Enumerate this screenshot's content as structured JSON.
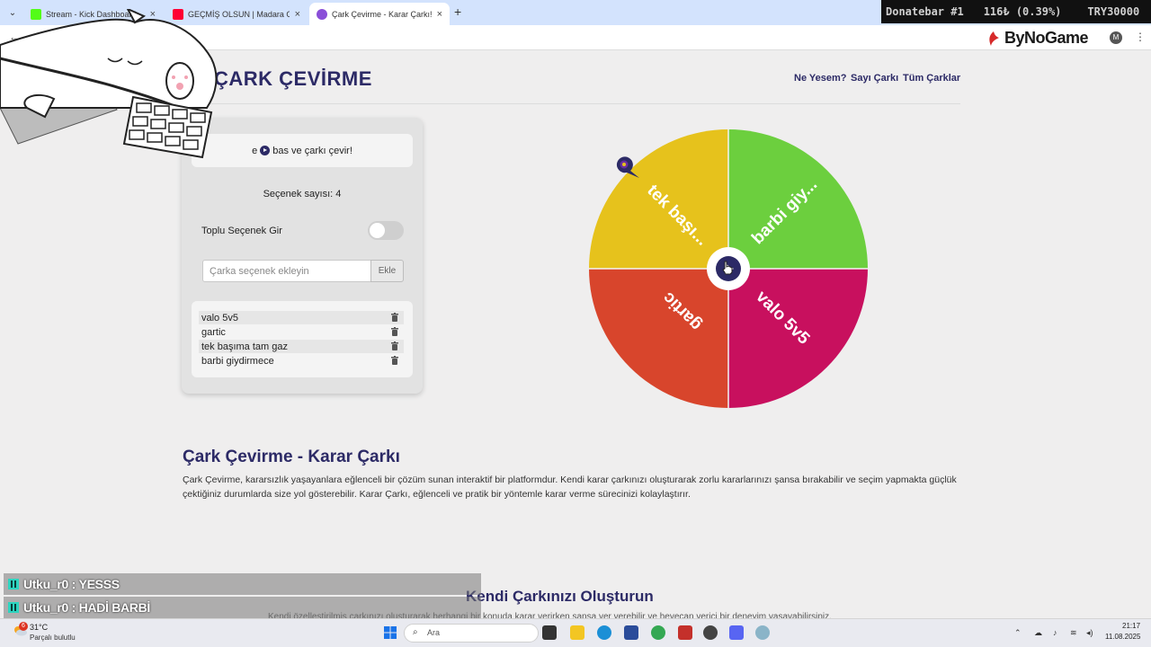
{
  "browser": {
    "tabs": [
      {
        "title": "Stream - Kick Dashboard",
        "favicon_color": "#53fc18"
      },
      {
        "title": "GEÇMİŞ OLSUN | Madara Olduk",
        "favicon_color": "#ff0033"
      },
      {
        "title": "Çark Çevirme - Karar Çarkı!",
        "favicon_color": "#8a4fd8"
      }
    ],
    "new_tab": "+",
    "menu_icon": "chevron-down-icon"
  },
  "donatebar": {
    "label": "Donatebar #1",
    "amount": "116₺ (0.39%)",
    "total": "TRY30000"
  },
  "bynogame": {
    "logo_text": "ByNoGame",
    "profile_initial": "M"
  },
  "site": {
    "title": "ÇARK ÇEVİRME",
    "nav": [
      "Ne Yesem?",
      "Sayı Çarkı",
      "Tüm Çarklar"
    ]
  },
  "panel": {
    "hint_before": "e",
    "hint_after": "bas ve çarkı çevir!",
    "option_count": "Seçenek sayısı: 4",
    "bulk_label": "Toplu Seçenek Gir",
    "bulk_enabled": false,
    "input_placeholder": "Çarka seçenek ekleyin",
    "add_label": "Ekle",
    "options": [
      "valo 5v5",
      "gartic",
      "tek başıma tam gaz",
      "barbi giydirmece"
    ]
  },
  "wheel": {
    "segments": [
      {
        "label": "barbi giy...",
        "color": "#6ccf3e"
      },
      {
        "label": "valo 5v5",
        "color": "#c8105e"
      },
      {
        "label": "gartic",
        "color": "#d8452c"
      },
      {
        "label": "tek başı...",
        "color": "#e6c21c"
      }
    ],
    "center_color": "#2c2a66"
  },
  "section1": {
    "title": "Çark Çevirme - Karar Çarkı",
    "text": "Çark Çevirme, kararsızlık yaşayanlara eğlenceli bir çözüm sunan interaktif bir platformdur. Kendi karar çarkınızı oluşturarak zorlu kararlarınızı şansa bırakabilir ve seçim yapmakta güçlük çektiğiniz durumlarda size yol gösterebilir. Karar Çarkı, eğlenceli ve pratik bir yöntemle karar verme sürecinizi kolaylaştırır."
  },
  "section2": {
    "title": "Kendi Çarkınızı Oluşturun",
    "text": "Kendi özelleştirilmiş çarkınızı oluşturarak herhangi bir konuda karar verirken şansa yer verebilir ve heyecan verici bir deneyim yaşayabilirsiniz."
  },
  "chat": [
    {
      "user": "Utku_r0",
      "message": "YESSS"
    },
    {
      "user": "Utku_r0",
      "message": "HADİ BARBİ"
    }
  ],
  "taskbar": {
    "weather_temp": "31°C",
    "weather_desc": "Parçalı bulutlu",
    "weather_badge": "6",
    "search_placeholder": "Ara",
    "time": "21:17",
    "date": "11.08.2025"
  }
}
